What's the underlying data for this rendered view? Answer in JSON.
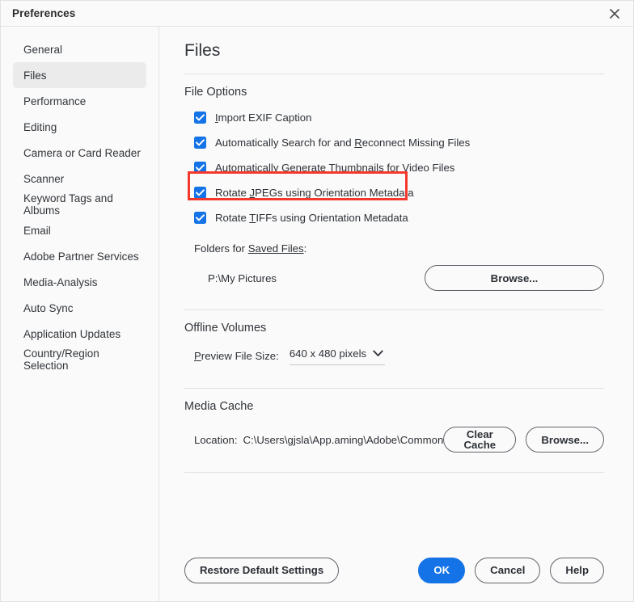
{
  "window": {
    "title": "Preferences",
    "close_icon": "close-icon"
  },
  "sidebar": {
    "items": [
      {
        "label": "General",
        "selected": false
      },
      {
        "label": "Files",
        "selected": true
      },
      {
        "label": "Performance",
        "selected": false
      },
      {
        "label": "Editing",
        "selected": false
      },
      {
        "label": "Camera or Card Reader",
        "selected": false
      },
      {
        "label": "Scanner",
        "selected": false
      },
      {
        "label": "Keyword Tags and Albums",
        "selected": false
      },
      {
        "label": "Email",
        "selected": false
      },
      {
        "label": "Adobe Partner Services",
        "selected": false
      },
      {
        "label": "Media-Analysis",
        "selected": false
      },
      {
        "label": "Auto Sync",
        "selected": false
      },
      {
        "label": "Application Updates",
        "selected": false
      },
      {
        "label": "Country/Region Selection",
        "selected": false
      }
    ]
  },
  "main": {
    "page_title": "Files",
    "file_options": {
      "section_title": "File Options",
      "checkboxes": [
        {
          "pre": "",
          "mnemonic": "I",
          "post": "mport EXIF Caption",
          "checked": true
        },
        {
          "pre": "Automatically Search for and ",
          "mnemonic": "R",
          "post": "econnect Missing Files",
          "checked": true
        },
        {
          "pre": "Automatically Generate Th",
          "mnemonic": "u",
          "post": "mbnails for Video Files",
          "checked": true
        },
        {
          "pre": "Rotate ",
          "mnemonic": "J",
          "post": "PEGs using Orientation Metadata",
          "checked": true,
          "highlighted": true
        },
        {
          "pre": "Rotate ",
          "mnemonic": "T",
          "post": "IFFs using Orientation Metadata",
          "checked": true
        }
      ],
      "folders_label_pre": "Folders for ",
      "folders_label_mnemonic": "Saved Files",
      "folders_label_post": ":",
      "folder_path": "P:\\My Pictures",
      "browse_label": "Browse..."
    },
    "offline_volumes": {
      "section_title": "Offline Volumes",
      "preview_label_mnemonic": "P",
      "preview_label_rest": "review File Size:",
      "preview_value": "640 x 480 pixels",
      "chevron_icon": "chevron-down-icon"
    },
    "media_cache": {
      "section_title": "Media Cache",
      "location_label": "Location:",
      "location_value": "C:\\Users\\gjsla\\App.aming\\Adobe\\Common",
      "clear_cache_label": "Clear Cache",
      "browse_label": "Browse..."
    }
  },
  "footer": {
    "restore_label": "Restore Default Settings",
    "ok_label": "OK",
    "cancel_label": "Cancel",
    "help_label": "Help"
  },
  "colors": {
    "accent_blue": "#1473e6",
    "highlight_red": "#f5382c",
    "sidebar_selected": "#ebebeb",
    "background": "#fafafa"
  }
}
